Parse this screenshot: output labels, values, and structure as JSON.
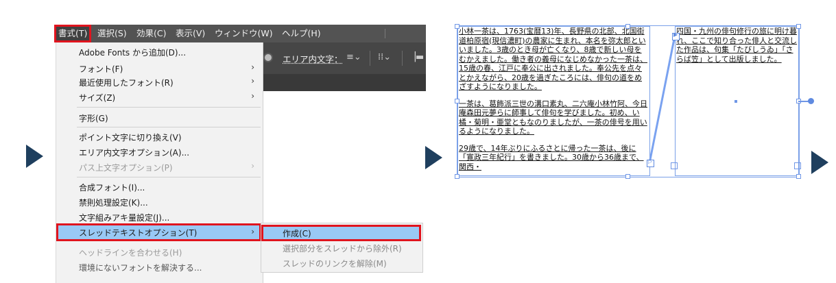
{
  "menubar": {
    "items": [
      "書式(T)",
      "選択(S)",
      "効果(C)",
      "表示(V)",
      "ウィンドウ(W)",
      "ヘルプ(H)"
    ],
    "active_index": 0
  },
  "control_bar": {
    "area_type_label": "エリア内文字：",
    "paragraph_icon": "align-lines-icon",
    "columns_icon": "columns-grid-icon",
    "align_icon": "align-left-icon"
  },
  "type_menu": {
    "items": [
      {
        "label": "Adobe Fonts から追加(D)...",
        "submenu": false,
        "disabled": false
      },
      {
        "label": "フォント(F)",
        "submenu": true,
        "disabled": false
      },
      {
        "label": "最近使用したフォント(R)",
        "submenu": true,
        "disabled": false
      },
      {
        "label": "サイズ(Z)",
        "submenu": true,
        "disabled": false
      },
      {
        "label": "字形(G)",
        "submenu": false,
        "disabled": false
      },
      {
        "label": "ポイント文字に切り換え(V)",
        "submenu": false,
        "disabled": false
      },
      {
        "label": "エリア内文字オプション(A)...",
        "submenu": false,
        "disabled": false
      },
      {
        "label": "パス上文字オプション(P)",
        "submenu": true,
        "disabled": true
      },
      {
        "label": "合成フォント(I)...",
        "submenu": false,
        "disabled": false
      },
      {
        "label": "禁則処理設定(K)...",
        "submenu": false,
        "disabled": false
      },
      {
        "label": "文字組みアキ量設定(J)...",
        "submenu": false,
        "disabled": false
      },
      {
        "label": "スレッドテキストオプション(T)",
        "submenu": true,
        "disabled": false,
        "highlighted": true
      },
      {
        "label": "ヘッドラインを合わせる(H)",
        "submenu": false,
        "disabled": true
      },
      {
        "label": "環境にないフォントを解決する...",
        "submenu": false,
        "disabled": false
      }
    ]
  },
  "thread_submenu": {
    "items": [
      {
        "label": "作成(C)",
        "disabled": false,
        "highlighted": true
      },
      {
        "label": "選択部分をスレッドから除外(R)",
        "disabled": true
      },
      {
        "label": "スレッドのリンクを解除(M)",
        "disabled": true
      }
    ]
  },
  "text_frames": {
    "frame1_paragraphs": [
      "小林一茶は、1763(宝暦13)年、長野県の北部、北国街道柏原宿(現信濃町)の農家に生まれ、本名を弥太郎といいました。3歳のとき母が亡くなり、8歳で新しい母をむかえました。働き者の義母になじめなかった一茶は、15歳の春、江戸に奉公に出されました。奉公先を点々とかえながら、20歳を過ぎたころには、俳句の道をめざすようになりました。",
      "一茶は、葛飾派三世の溝口素丸、二六庵小林竹阿、今日庵森田元夢らに師事して俳句を学びました。初め、い橘・菊明・亜堂ともなのりましたが、一茶の俳号を用いるようになりました。",
      "29歳で、14年ぶりにふるさとに帰った一茶は、後に「寛政三年紀行」を書きました。30歳から36歳まで、関西・"
    ],
    "frame2_paragraphs": [
      "四国・九州の俳句修行の旅に明け暮れ、ここで知り合った俳人と交流した作品は、句集「たびしうゐ」「さらば笠」として出版しました。"
    ],
    "port_in_symbol": "▷",
    "port_out_symbol": "▶"
  },
  "colors": {
    "menubar_bg": "#535353",
    "menu_bg": "#f2f2f2",
    "highlight_bg": "#99c9f5",
    "callout_red": "#e0141e",
    "selection_blue": "#5f8ae0",
    "arrow": "#1f3f5e"
  }
}
